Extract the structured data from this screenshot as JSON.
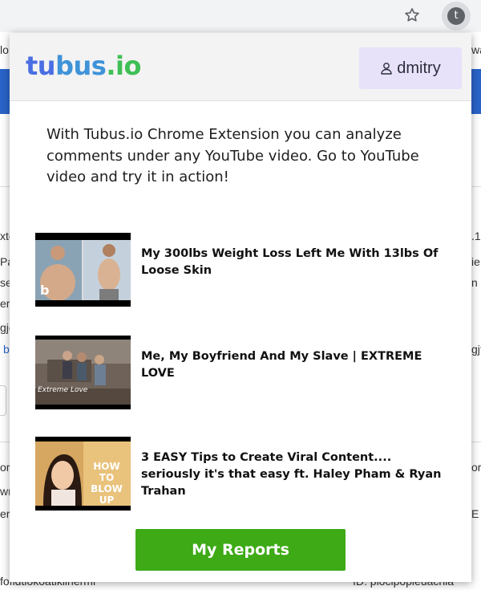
{
  "extension": {
    "badge_letter": "t"
  },
  "background": {
    "left_fragments": [
      "lo",
      "xte",
      "Pa",
      "se",
      "er",
      "gjc",
      "b",
      "or",
      "wn",
      "er",
      "fofidtiokoatiklihermi"
    ],
    "right_fragments": [
      "wa",
      ".1",
      "ie",
      "n",
      "gjf",
      "or",
      "E",
      "ID: plocipopleuacnia"
    ]
  },
  "header": {
    "logo_parts": [
      {
        "text": "tu",
        "color": "#4a6fe3"
      },
      {
        "text": "bus",
        "color": "#3f93d9"
      },
      {
        "text": ".io",
        "color": "#3fbf56"
      }
    ],
    "user": {
      "name": "dmitry",
      "icon": "user-icon"
    }
  },
  "intro_text": "With Tubus.io Chrome Extension you can analyze comments under any YouTube video. Go to YouTube video and try it in action!",
  "videos": [
    {
      "title": "My 300lbs Weight Loss Left Me With 13lbs Of Loose Skin",
      "thumb_caption": "b"
    },
    {
      "title": "Me, My Boyfriend And My Slave | EXTREME LOVE",
      "thumb_caption": "Extreme Love"
    },
    {
      "title": "3 EASY Tips to Create Viral Content.... seriously it's that easy ft. Haley Pham & Ryan Trahan",
      "thumb_caption": "HOW TO BLOW UP"
    }
  ],
  "actions": {
    "reports_label": "My Reports"
  },
  "colors": {
    "accent_button": "#3daa16",
    "user_button_bg": "#e7e2fa",
    "browser_bar": "#f1f3f4"
  }
}
